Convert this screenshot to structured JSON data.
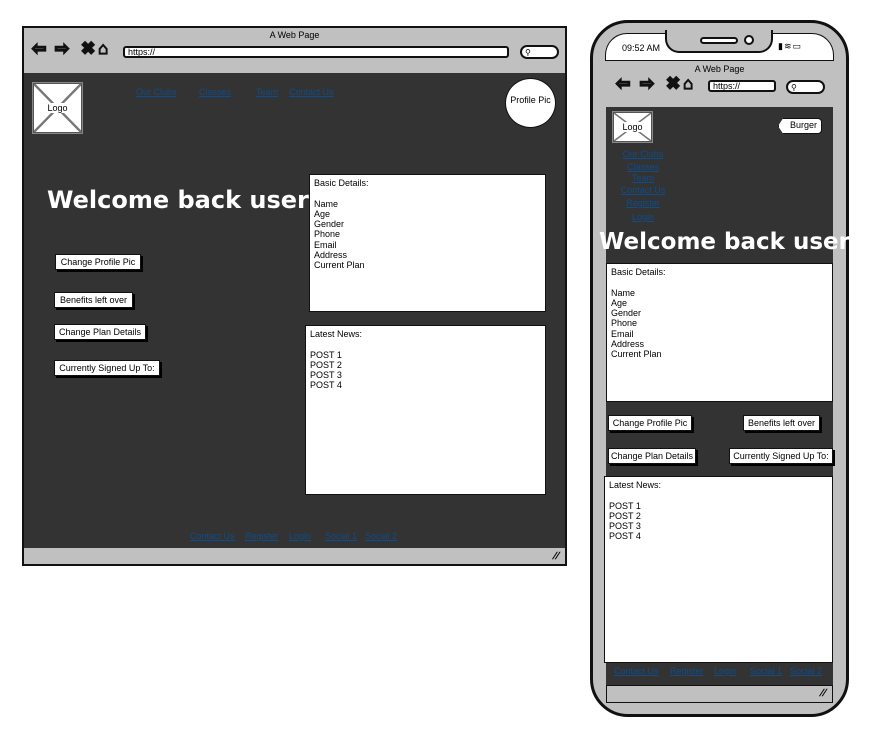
{
  "browser": {
    "title": "A Web Page",
    "url": "https://"
  },
  "header": {
    "logo": "Logo",
    "profile_pic": "Profile Pic",
    "burger": "Burger"
  },
  "nav": [
    "Our Clubs",
    "Classes",
    "Team",
    "Contact Us"
  ],
  "mobile_nav": [
    "Our Clubs",
    "Classes",
    "Team",
    "Contact Us",
    "Register",
    "Login"
  ],
  "welcome": "Welcome back user!",
  "basic_details": {
    "heading": "Basic Details:",
    "fields": [
      "Name",
      "Age",
      "Gender",
      "Phone",
      "Email",
      "Address",
      "Current Plan"
    ]
  },
  "buttons": {
    "change_profile_pic": "Change Profile Pic",
    "benefits": "Benefits left over",
    "change_plan": "Change Plan Details",
    "signed_up": "Currently Signed Up To:"
  },
  "news": {
    "heading": "Latest News:",
    "posts": [
      "POST 1",
      "POST 2",
      "POST 3",
      "POST 4"
    ]
  },
  "footer": [
    "Contact Us",
    "Register",
    "Login",
    "Social 1",
    "Social 2"
  ],
  "phone": {
    "time": "09:52 AM"
  }
}
